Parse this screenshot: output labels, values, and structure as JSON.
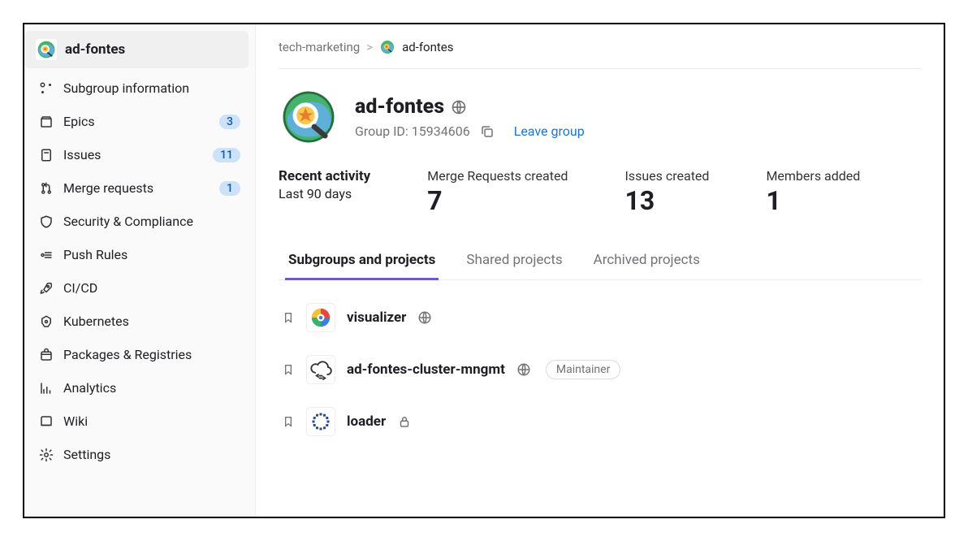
{
  "sidebar": {
    "header_label": "ad-fontes",
    "items": [
      {
        "icon": "subgroup",
        "label": "Subgroup information",
        "count": null
      },
      {
        "icon": "epic",
        "label": "Epics",
        "count": "3"
      },
      {
        "icon": "issues",
        "label": "Issues",
        "count": "11"
      },
      {
        "icon": "mr",
        "label": "Merge requests",
        "count": "1"
      },
      {
        "icon": "shield",
        "label": "Security & Compliance",
        "count": null
      },
      {
        "icon": "push",
        "label": "Push Rules",
        "count": null
      },
      {
        "icon": "rocket",
        "label": "CI/CD",
        "count": null
      },
      {
        "icon": "kube",
        "label": "Kubernetes",
        "count": null
      },
      {
        "icon": "package",
        "label": "Packages & Registries",
        "count": null
      },
      {
        "icon": "analytics",
        "label": "Analytics",
        "count": null
      },
      {
        "icon": "wiki",
        "label": "Wiki",
        "count": null
      },
      {
        "icon": "settings",
        "label": "Settings",
        "count": null
      }
    ]
  },
  "breadcrumb": {
    "root": "tech-marketing",
    "separator": ">",
    "current": "ad-fontes"
  },
  "group": {
    "name": "ad-fontes",
    "id_label": "Group ID: 15934606",
    "leave_label": "Leave group"
  },
  "activity": {
    "title": "Recent activity",
    "subtitle": "Last 90 days",
    "stats": [
      {
        "label": "Merge Requests created",
        "value": "7"
      },
      {
        "label": "Issues created",
        "value": "13"
      },
      {
        "label": "Members added",
        "value": "1"
      }
    ]
  },
  "tabs": [
    {
      "label": "Subgroups and projects",
      "active": true
    },
    {
      "label": "Shared projects",
      "active": false
    },
    {
      "label": "Archived projects",
      "active": false
    }
  ],
  "projects": [
    {
      "name": "visualizer",
      "visibility": "public",
      "role": null,
      "avatar": "viz"
    },
    {
      "name": "ad-fontes-cluster-mngmt",
      "visibility": "public",
      "role": "Maintainer",
      "avatar": "cloud"
    },
    {
      "name": "loader",
      "visibility": "private",
      "role": null,
      "avatar": "ring"
    }
  ]
}
